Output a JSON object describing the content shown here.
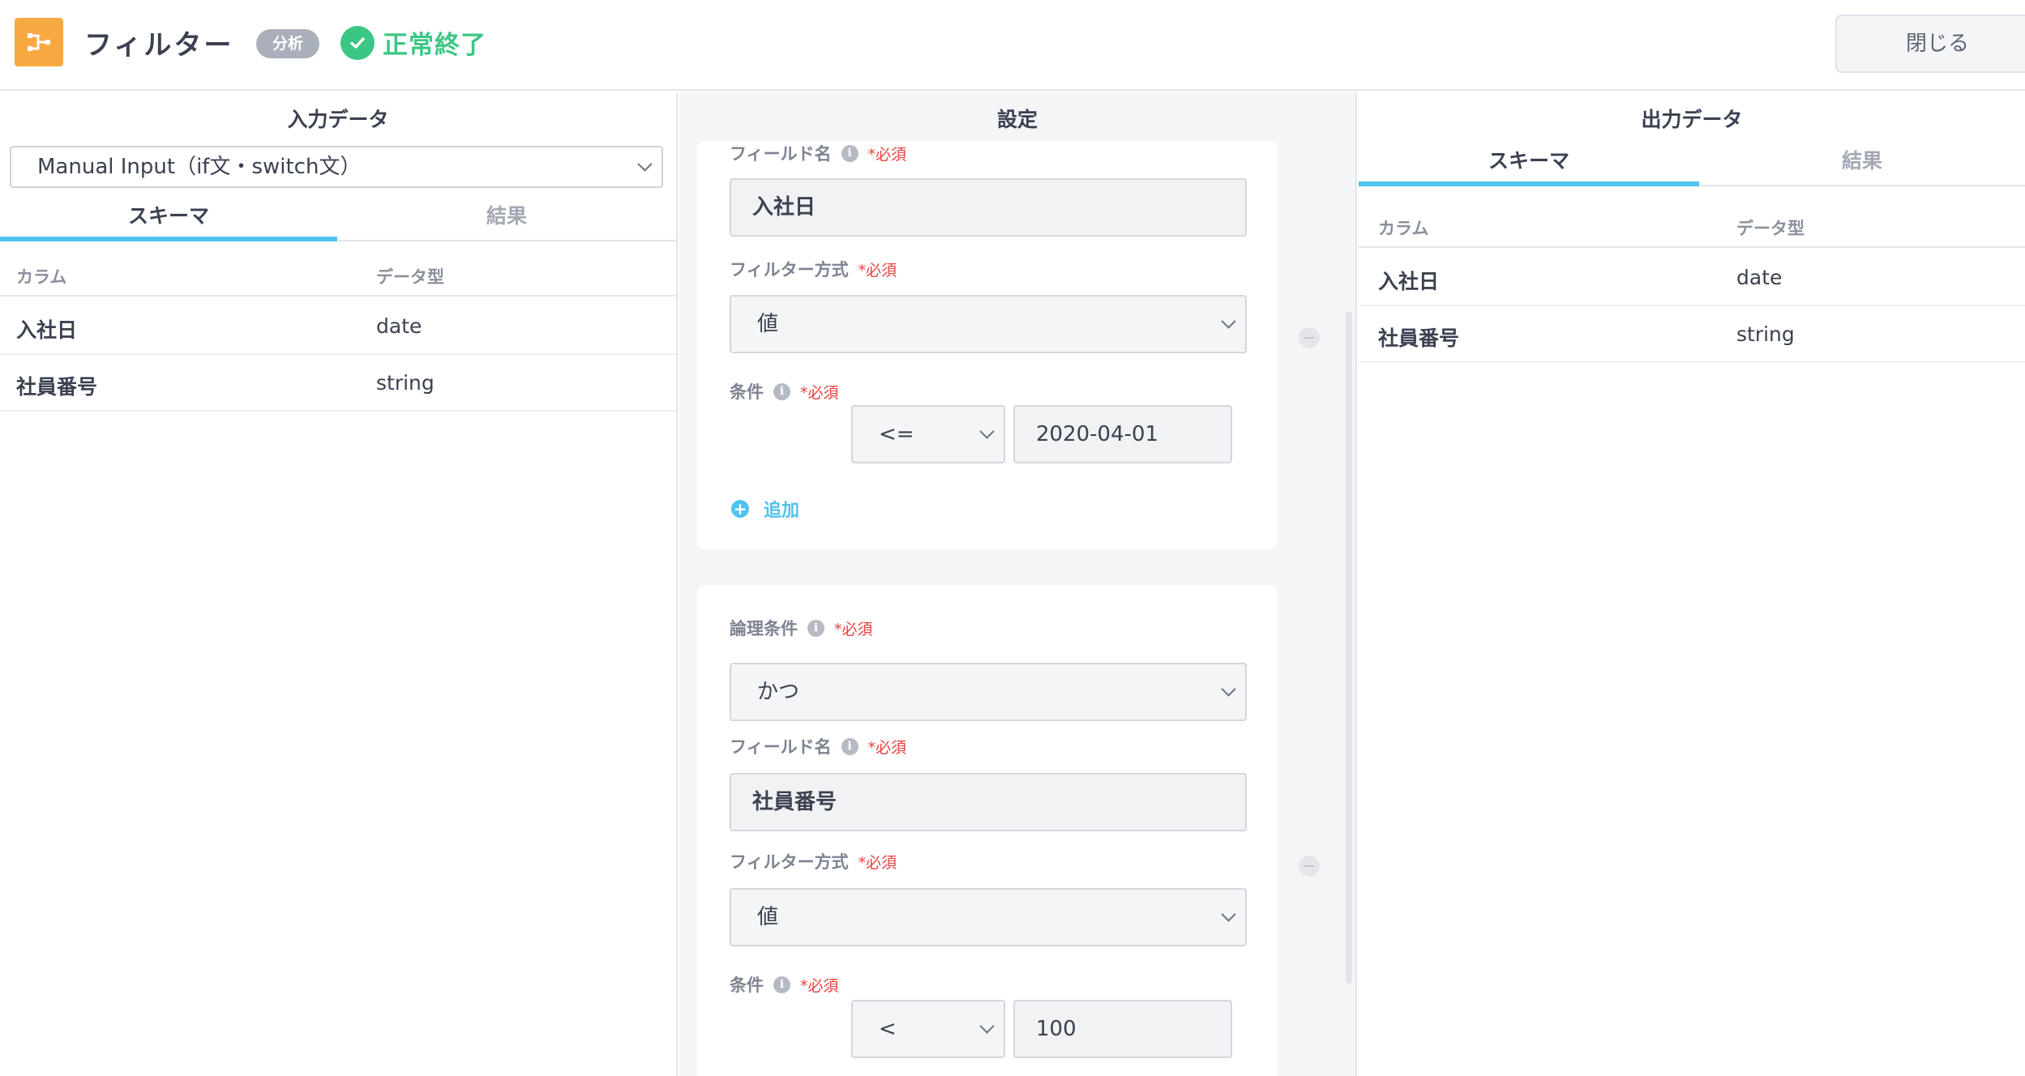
{
  "header": {
    "title": "フィルター",
    "tag": "分析",
    "status": "正常終了",
    "close_label": "閉じる"
  },
  "input_panel": {
    "title": "入力データ",
    "source": "Manual Input（if文・switch文）",
    "tabs": [
      {
        "label": "スキーマ",
        "active": true
      },
      {
        "label": "結果",
        "active": false
      }
    ],
    "columns": {
      "name": "カラム",
      "type": "データ型"
    },
    "rows": [
      {
        "name": "入社日",
        "type": "date"
      },
      {
        "name": "社員番号",
        "type": "string"
      }
    ]
  },
  "settings_panel": {
    "title": "設定",
    "required_mark": "*必須",
    "filter1": {
      "field_label": "フィールド名",
      "field_value": "入社日",
      "method_label": "フィルター方式",
      "method_value": "値",
      "condition_label": "条件",
      "operator": "<=",
      "value": "2020-04-01",
      "add_label": "追加"
    },
    "filter2": {
      "logic_label": "論理条件",
      "logic_value": "かつ",
      "field_label": "フィールド名",
      "field_value": "社員番号",
      "method_label": "フィルター方式",
      "method_value": "値",
      "condition_label": "条件",
      "operator": "<",
      "value": "100"
    }
  },
  "output_panel": {
    "title": "出力データ",
    "tabs": [
      {
        "label": "スキーマ",
        "active": true
      },
      {
        "label": "結果",
        "active": false
      }
    ],
    "columns": {
      "name": "カラム",
      "type": "データ型"
    },
    "rows": [
      {
        "name": "入社日",
        "type": "date"
      },
      {
        "name": "社員番号",
        "type": "string"
      }
    ]
  },
  "colors": {
    "accent": "#4ec3f0",
    "success": "#3cc685",
    "app_icon": "#f7a941",
    "required": "#e8423f"
  },
  "icons": [
    "filter-node-icon",
    "check-circle-icon",
    "info-icon",
    "chevron-down-icon",
    "plus-circle-icon",
    "minus-circle-icon"
  ]
}
